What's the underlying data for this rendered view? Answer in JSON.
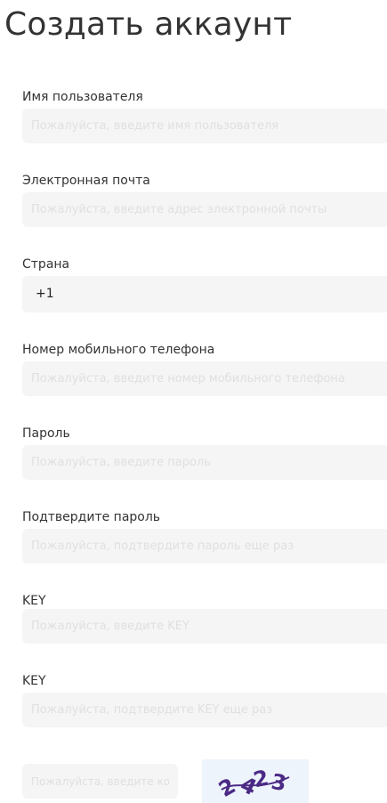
{
  "header": {
    "title": "Создать аккаунт"
  },
  "form": {
    "username": {
      "label": "Имя пользователя",
      "placeholder": "Пожалуйста, введите имя пользователя",
      "value": ""
    },
    "email": {
      "label": "Электронная почта",
      "placeholder": "Пожалуйста, введите адрес электронной почты",
      "value": ""
    },
    "country": {
      "label": "Страна",
      "value": "+1"
    },
    "phone": {
      "label": "Номер мобильного телефона",
      "placeholder": "Пожалуйста, введите номер мобильного телефона",
      "value": ""
    },
    "password": {
      "label": "Пароль",
      "placeholder": "Пожалуйста, введите пароль",
      "value": ""
    },
    "confirm_password": {
      "label": "Подтвердите пароль",
      "placeholder": "Пожалуйста, подтвердите пароль еще раз",
      "value": ""
    },
    "key": {
      "label": "KEY",
      "placeholder": "Пожалуйста, введите KEY",
      "value": ""
    },
    "confirm_key": {
      "label": "KEY",
      "placeholder": "Пожалуйста, подтвердите KEY еще раз",
      "value": ""
    },
    "captcha": {
      "placeholder": "Пожалуйста, введите код",
      "image_text": "2423",
      "image_text_color": "#4b2a86",
      "image_background": "#eef4fb"
    }
  },
  "colors": {
    "field_background": "#f5f5f5",
    "text": "#333333"
  }
}
